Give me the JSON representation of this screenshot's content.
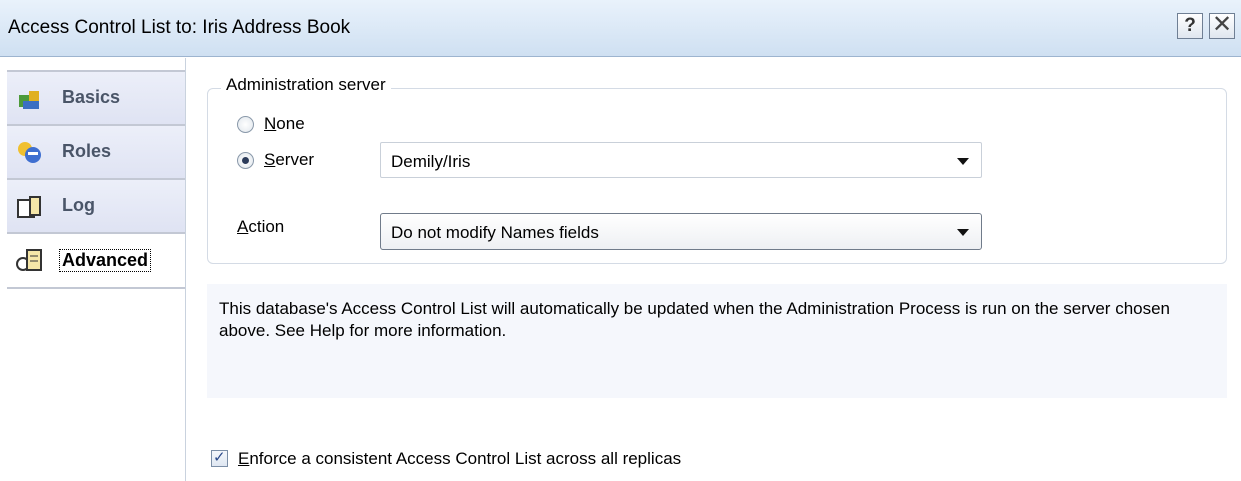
{
  "window": {
    "title": "Access Control List to: Iris Address Book",
    "help_label": "?",
    "close_label": "✕"
  },
  "sidebar": {
    "items": [
      {
        "label": "Basics",
        "icon": "people-icon"
      },
      {
        "label": "Roles",
        "icon": "roles-icon"
      },
      {
        "label": "Log",
        "icon": "log-icon"
      },
      {
        "label": "Advanced",
        "icon": "key-scroll-icon",
        "active": true
      }
    ]
  },
  "admin": {
    "group_label": "Administration server",
    "none_label": "None",
    "none_accel": "N",
    "none_rest": "one",
    "server_accel": "S",
    "server_rest": "erver",
    "server_value": "Demily/Iris",
    "selected": "Server",
    "action_accel": "A",
    "action_rest": "ction",
    "action_value": "Do not modify Names fields"
  },
  "info": {
    "text": "This database's Access Control List will automatically be updated when the Administration Process is run on the server chosen above. See Help for more information."
  },
  "enforce": {
    "accel": "E",
    "rest": "nforce a consistent Access Control List across all replicas",
    "checked": true
  },
  "colors": {
    "titlebar": "#cfe0f2",
    "tab_bg": "#dfe3f3",
    "info_bg": "#f5f7fc"
  }
}
